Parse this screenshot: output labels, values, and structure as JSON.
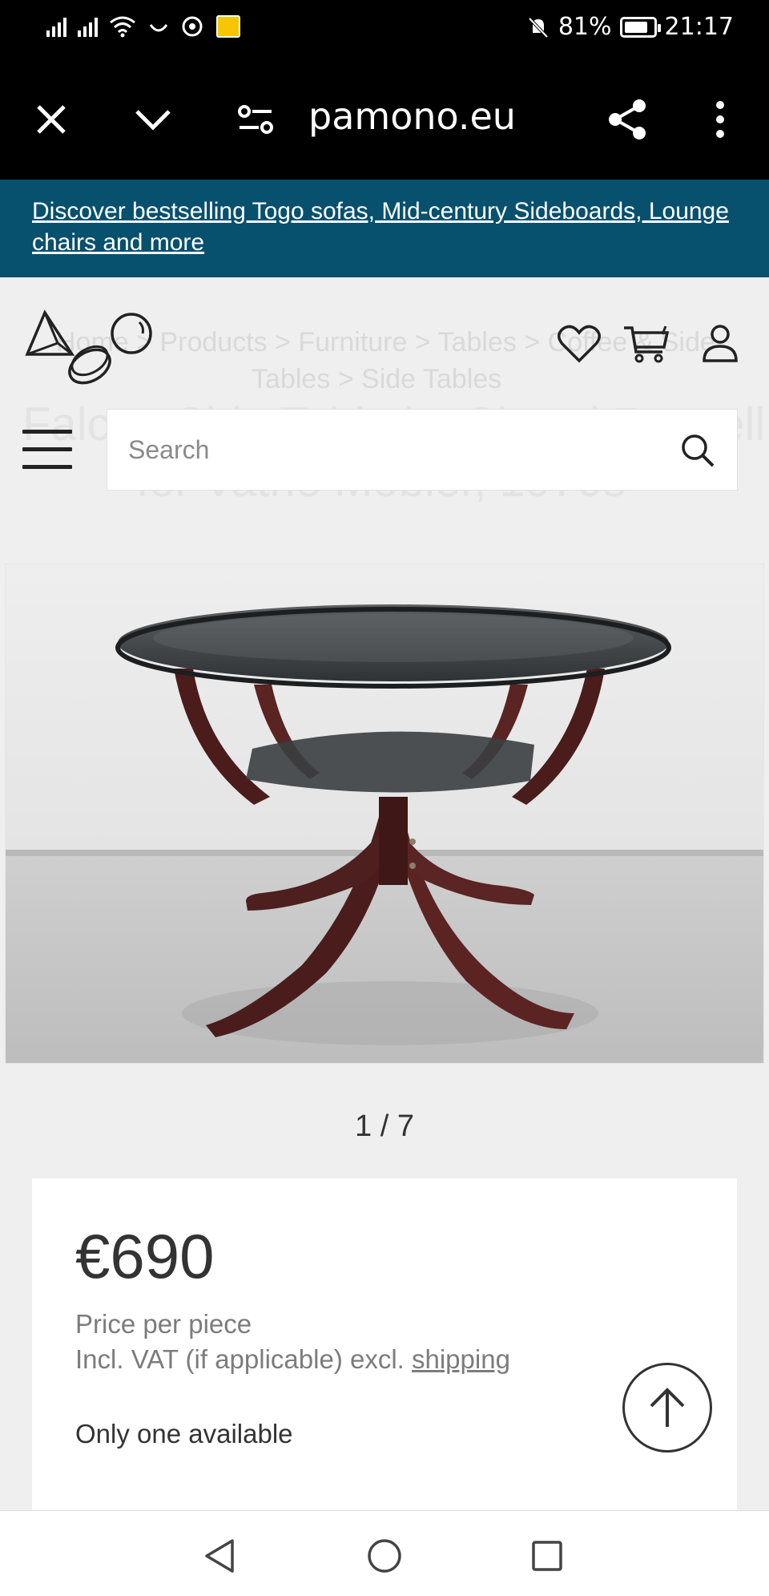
{
  "status_bar": {
    "battery": "81%",
    "battery_level": 0.81,
    "time": "21:17"
  },
  "browser": {
    "url": "pamono.eu",
    "close_icon": "close-icon",
    "collapse_icon": "chevron-down-icon",
    "site_settings_icon": "tune-icon",
    "share_icon": "share-icon",
    "menu_icon": "more-vert-icon"
  },
  "promo": {
    "text": "Discover bestselling Togo sofas, Mid-century Sideboards, Lounge chairs and more"
  },
  "header": {
    "breadcrumb_line1": "Home > Products > Furniture > Tables > Coffee & Side",
    "breadcrumb_line2": "Tables > Side Tables",
    "title_line1": "Falcon Side Table by Sigurd Ressell",
    "title_line2": "for Vatne Mobler, 1970s",
    "search_placeholder": "Search",
    "icons": [
      "heart-icon",
      "cart-icon",
      "user-icon",
      "search-icon",
      "menu-icon"
    ]
  },
  "gallery": {
    "counter": "1 / 7"
  },
  "price_card": {
    "price": "€690",
    "price_per": "Price per piece",
    "vat_note": "Incl. VAT (if applicable) excl. ",
    "shipping_link": "shipping",
    "availability": "Only one available"
  },
  "colors": {
    "promo_bg": "#07506e",
    "toolbar_bg": "#000000",
    "page_bg": "#efefef"
  }
}
